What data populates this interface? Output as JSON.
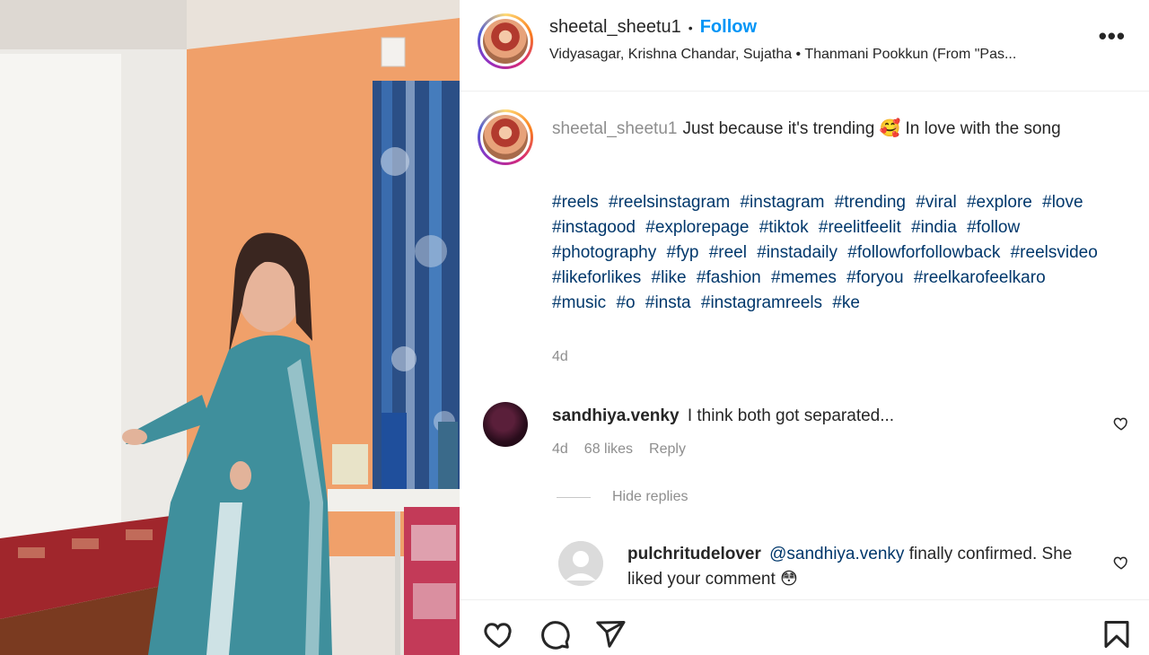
{
  "post": {
    "username": "sheetal_sheetu1",
    "follow_label": "Follow",
    "separator": "•",
    "audio": "Vidyasagar, Krishna Chandar, Sujatha • Thanmani Pookkun (From \"Pas...",
    "more_label": "•••"
  },
  "caption": {
    "username": "sheetal_sheetu1",
    "text": "Just because it's trending 🥰 In love with the song",
    "hashtags": [
      "#reels",
      "#reelsinstagram",
      "#instagram",
      "#trending",
      "#viral",
      "#explore",
      "#love",
      "#instagood",
      "#explorepage",
      "#tiktok",
      "#reelitfeelit",
      "#india",
      "#follow",
      "#photography",
      "#fyp",
      "#reel",
      "#instadaily",
      "#followforfollowback",
      "#reelsvideo",
      "#likeforlikes",
      "#like",
      "#fashion",
      "#memes",
      "#foryou",
      "#reelkarofeelkaro",
      "#music",
      "#o",
      "#insta",
      "#instagramreels",
      "#ke"
    ],
    "time": "4d"
  },
  "comments": [
    {
      "username": "sandhiya.venky",
      "text": "I think both got separated...",
      "time": "4d",
      "likes": "68 likes",
      "reply_label": "Reply"
    }
  ],
  "hide_replies_label": "Hide replies",
  "replies": [
    {
      "username": "pulchritudelover",
      "mention": "@sandhiya.venky",
      "text": "finally confirmed. She liked your comment 😳"
    }
  ],
  "colors": {
    "accent": "#0095f6",
    "hashtag": "#00376b",
    "muted": "#8e8e8e",
    "wall_orange": "#f0a06a"
  },
  "icons": {
    "like": "heart-icon",
    "comment": "comment-icon",
    "share": "share-icon",
    "save": "bookmark-icon"
  }
}
